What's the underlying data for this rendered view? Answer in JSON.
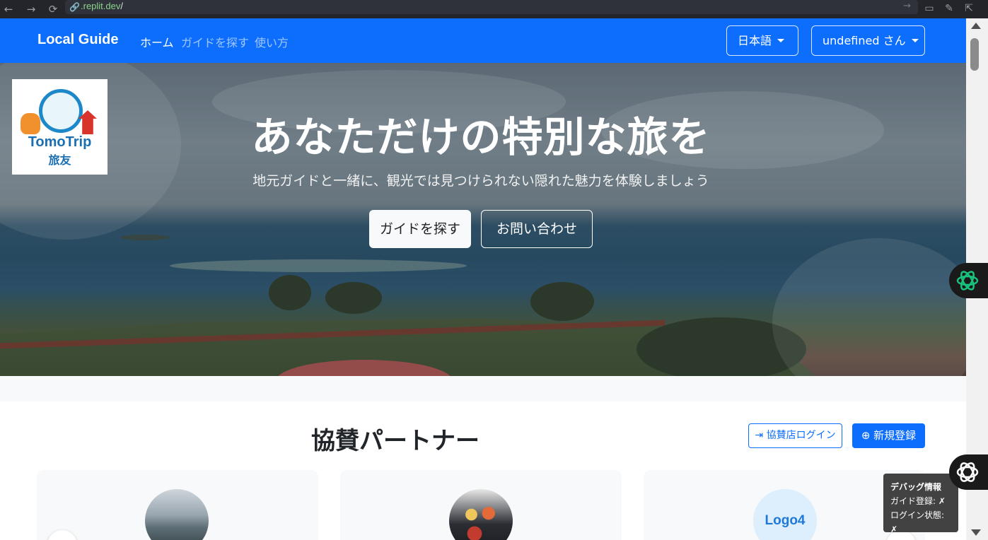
{
  "browser": {
    "url_host": ".replit.dev",
    "url_path": "/"
  },
  "navbar": {
    "brand": "Local Guide",
    "links": [
      "ホーム",
      "ガイドを探す",
      "使い方"
    ],
    "language": "日本語",
    "user": "undefined さん"
  },
  "hero": {
    "title": "あなただけの特別な旅を",
    "subtitle": "地元ガイドと一緒に、観光では見つけられない隠れた魅力を体験しましょう",
    "primary_button": "ガイドを探す",
    "secondary_button": "お問い合わせ",
    "logo_name": "TomoTrip",
    "logo_sub": "旅友"
  },
  "partners": {
    "title": "協賛パートナー",
    "login_button": "協賛店ログイン",
    "register_button": "新規登録",
    "cards": [
      {
        "image": "photo-sea"
      },
      {
        "image": "photo-food"
      },
      {
        "logo_text": "Logo4"
      }
    ]
  },
  "debug": {
    "title": "デバッグ情報",
    "guide_registered": "ガイド登録: ✗",
    "login_state": "ログイン状態: ✗"
  },
  "colors": {
    "primary": "#0d6efd",
    "navbar": "#0d6efd"
  }
}
